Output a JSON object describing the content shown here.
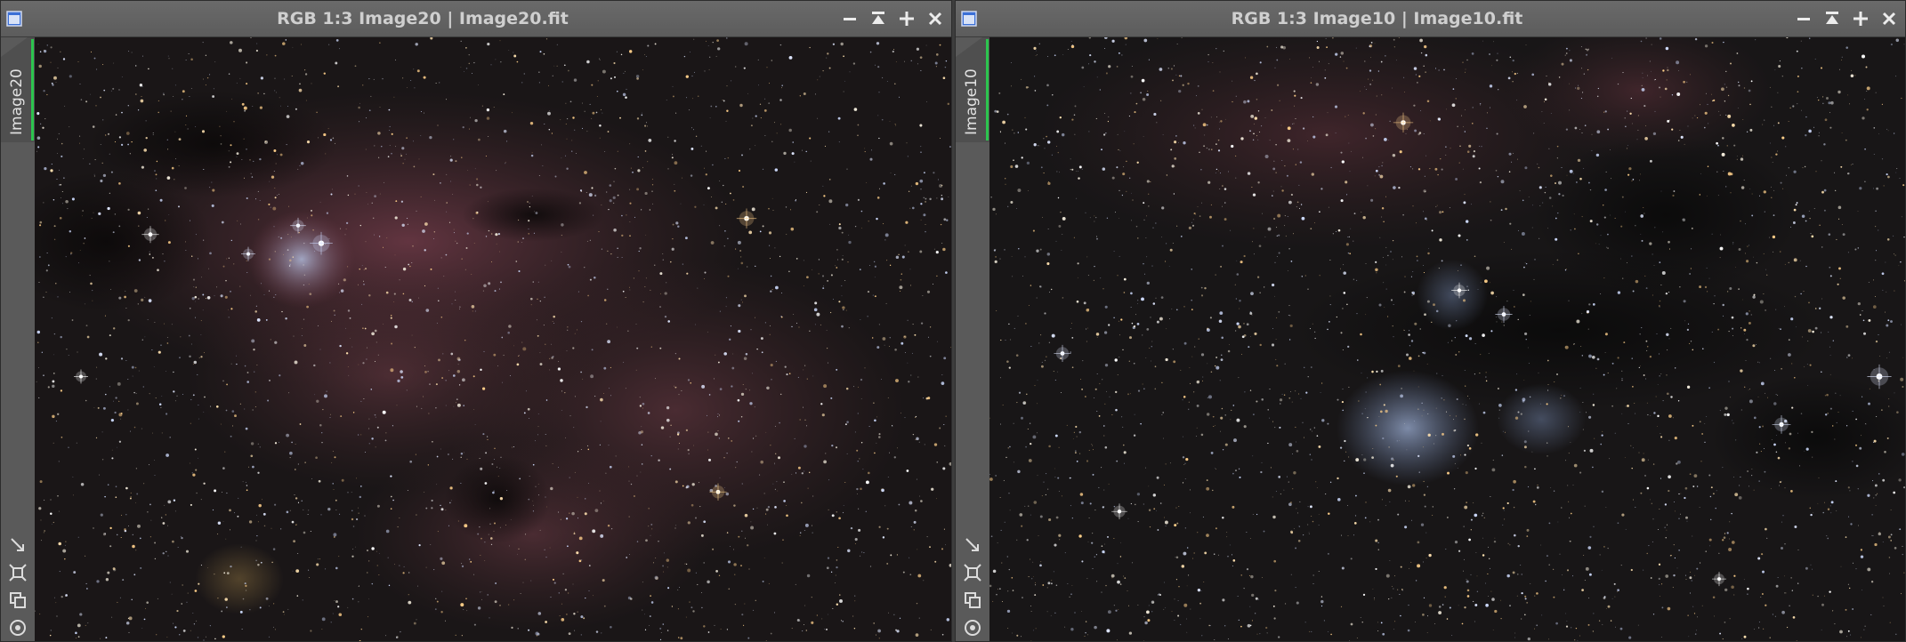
{
  "windows": [
    {
      "title": "RGB 1:3 Image20 | Image20.fit",
      "tab_label": "Image20",
      "accent_color": "#2cc44e"
    },
    {
      "title": "RGB 1:3 Image10 | Image10.fit",
      "tab_label": "Image10",
      "accent_color": "#2cc44e"
    }
  ],
  "title_controls": [
    "minimize-icon",
    "shade-icon",
    "maximize-icon",
    "close-icon"
  ],
  "side_tools": [
    "resize-arrow-icon",
    "fit-frame-icon",
    "clone-icon",
    "target-icon"
  ],
  "colors": {
    "frame_bg": "#5a5a5a",
    "title_text": "#cfcfcf",
    "sky_base": "#171414"
  }
}
